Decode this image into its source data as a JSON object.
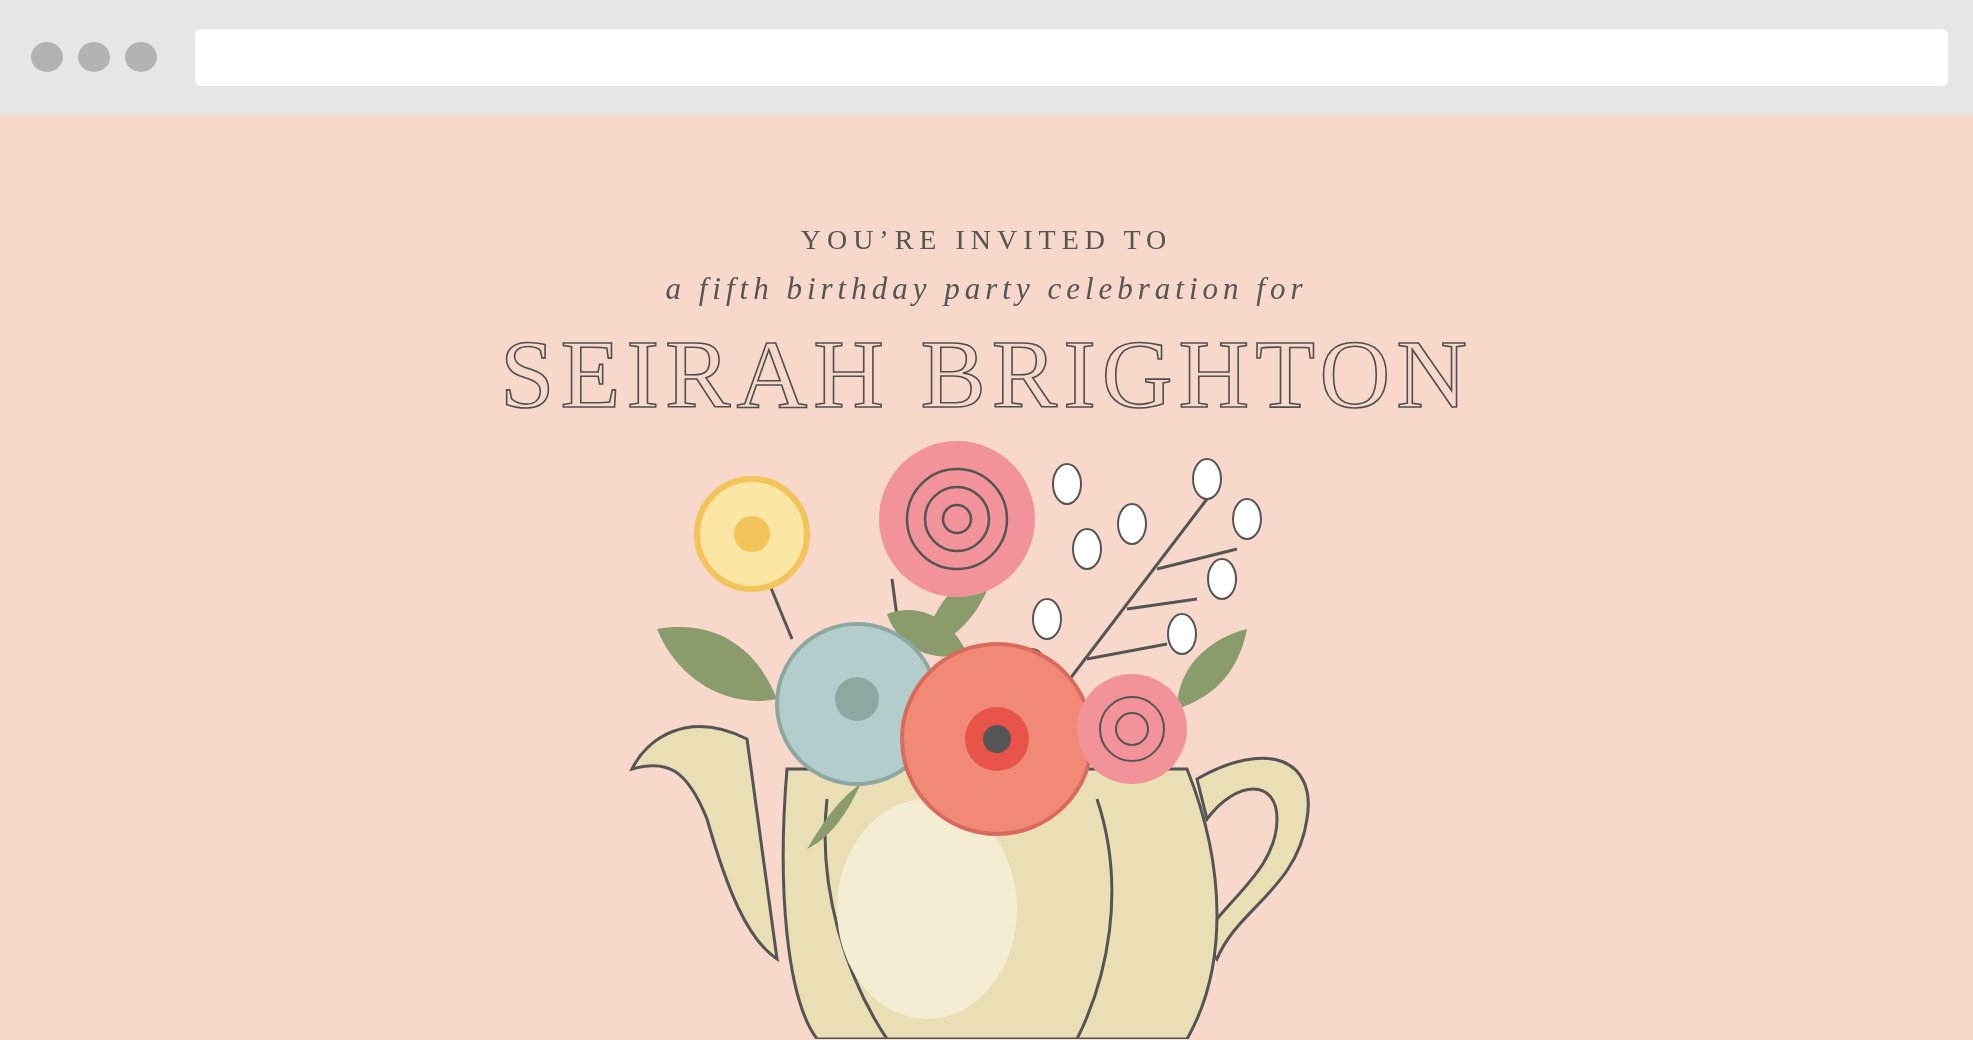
{
  "invitation": {
    "heading": "YOU’RE INVITED TO",
    "subheading": "a fifth birthday party celebration for",
    "name": "SEIRAH BRIGHTON"
  }
}
